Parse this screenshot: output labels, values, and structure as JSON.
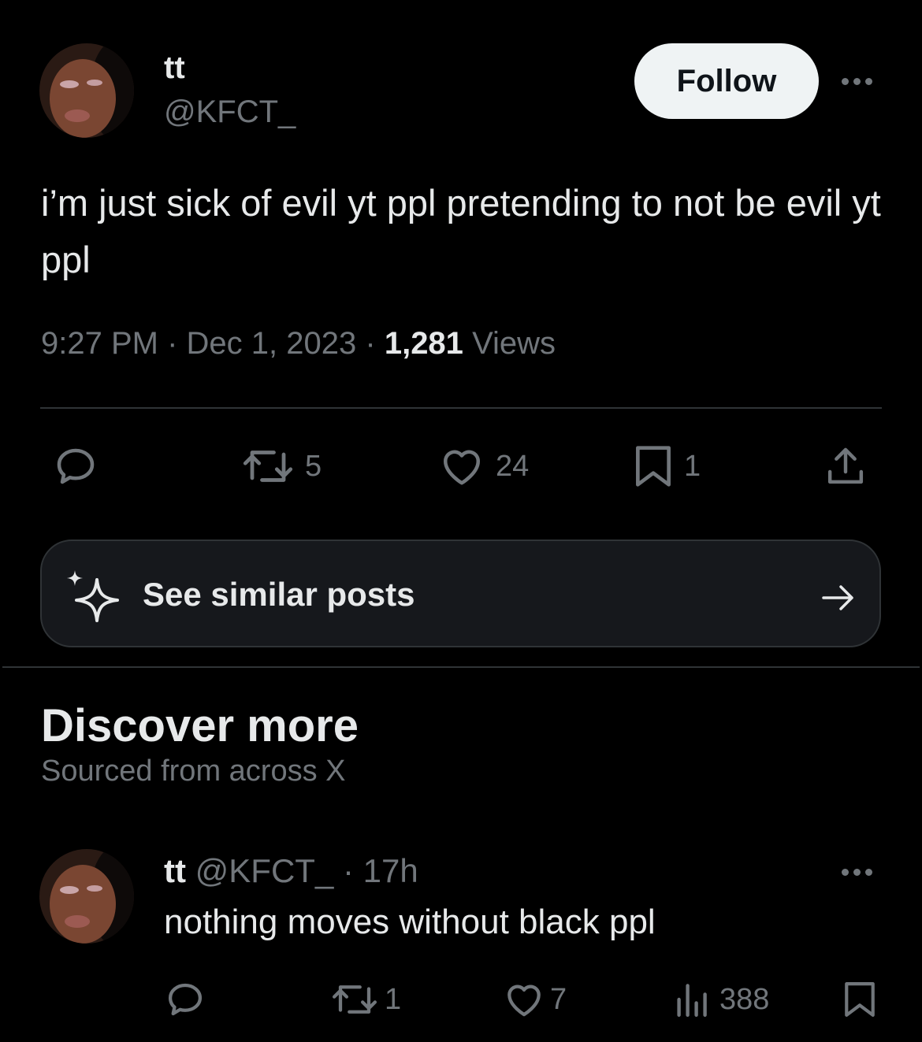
{
  "tweet": {
    "author": {
      "display_name": "tt",
      "handle": "@KFCT_",
      "avatar_icon": "profile-photo"
    },
    "follow_label": "Follow",
    "text": "i’m just sick of evil yt ppl pretending to not be evil yt ppl",
    "time": "9:27 PM",
    "date": "Dec 1, 2023",
    "views_count": "1,281",
    "views_label": "Views",
    "separator": "·",
    "actions": {
      "reply_icon": "reply-icon",
      "repost_count": "5",
      "like_count": "24",
      "bookmark_count": "1",
      "share_icon": "share-icon"
    }
  },
  "similar_posts": {
    "label": "See similar posts",
    "icon": "sparkle-icon",
    "arrow_icon": "arrow-right-icon"
  },
  "discover": {
    "title": "Discover more",
    "subtitle": "Sourced from across X"
  },
  "feed": [
    {
      "display_name": "tt",
      "handle": "@KFCT_",
      "separator": "·",
      "time_ago": "17h",
      "text": "nothing moves without black ppl",
      "repost_count": "1",
      "like_count": "7",
      "views_count": "388"
    }
  ],
  "colors": {
    "background": "#000000",
    "primary_text": "#e7e9ea",
    "secondary_text": "#71767b",
    "divider": "#2f3336",
    "follow_button_bg": "#eff3f4"
  }
}
